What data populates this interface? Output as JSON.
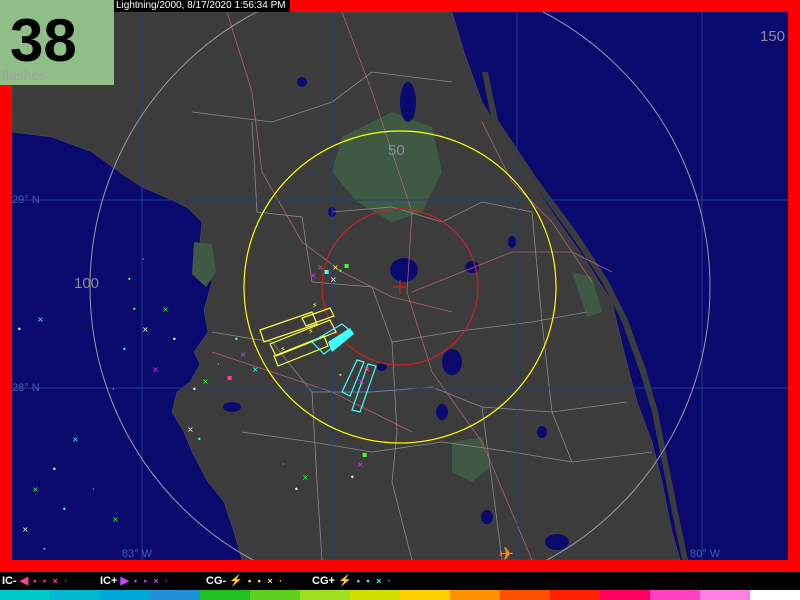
{
  "title": "Lightning/2000, 8/17/2020 1:56:34 PM",
  "flash_count": {
    "value": "38",
    "label": "flashes"
  },
  "range_labels": {
    "r50": "50",
    "r100": "100",
    "r150": "150"
  },
  "grid_labels": {
    "lat_29": "29° N",
    "lat_28": "28° N",
    "lon_83": "83° W",
    "lon_80": "80° W"
  },
  "legend": [
    {
      "label": "IC-",
      "color": "#ff3fa0",
      "marker": "◀",
      "dots": "• ▪ × ·"
    },
    {
      "label": "IC+",
      "color": "#d040ff",
      "marker": "▶",
      "dots": "• ▪ × ·"
    },
    {
      "label": "CG-",
      "color": "#ffff40",
      "marker": "⚡",
      "dots": "• ▪ × ·"
    },
    {
      "label": "CG+",
      "color": "#ffff40",
      "marker": "⚡",
      "dots": "• ▪ × ·"
    }
  ],
  "colors": {
    "frame": "#ff0000",
    "water": "#0a0a6e",
    "land": "#3c3c3c",
    "ring_inner": "#cc2222",
    "ring_50": "#ffff00",
    "ring_outer": "#9a9aaa",
    "cg_boxes": "#ffff40",
    "ic_boxes": "#40ffff"
  },
  "colorbar": [
    "#00c8c8",
    "#00b8d0",
    "#00a8d8",
    "#2090d8",
    "#20c020",
    "#60d020",
    "#a0e020",
    "#d0e000",
    "#ffd000",
    "#ff9000",
    "#ff5000",
    "#ff2000",
    "#ff0060",
    "#ff40c0",
    "#ff80e0",
    "#ffffff"
  ]
}
